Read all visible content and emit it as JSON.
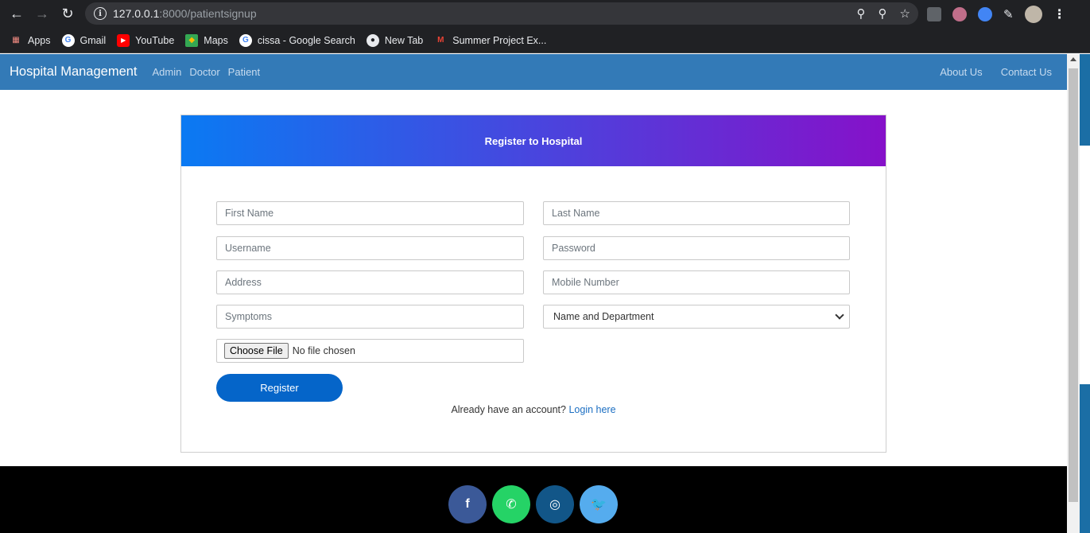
{
  "browser": {
    "url_host": "127.0.0.1",
    "url_rest": ":8000/patientsignup",
    "bookmarks": [
      {
        "label": "Apps"
      },
      {
        "label": "Gmail"
      },
      {
        "label": "YouTube"
      },
      {
        "label": "Maps"
      },
      {
        "label": "cissa - Google Search"
      },
      {
        "label": "New Tab"
      },
      {
        "label": "Summer Project Ex..."
      }
    ]
  },
  "navbar": {
    "brand": "Hospital Management",
    "left_links": [
      "Admin",
      "Doctor",
      "Patient"
    ],
    "right_links": [
      "About Us",
      "Contact Us"
    ]
  },
  "form": {
    "title": "Register to Hospital",
    "first_name_placeholder": "First Name",
    "last_name_placeholder": "Last Name",
    "username_placeholder": "Username",
    "password_placeholder": "Password",
    "address_placeholder": "Address",
    "mobile_placeholder": "Mobile Number",
    "symptoms_placeholder": "Symptoms",
    "department_selected": "Name and Department",
    "file_button": "Choose File",
    "file_status": "No file chosen",
    "submit_label": "Register",
    "login_prompt": "Already have an account?",
    "login_link": "Login here"
  },
  "footer": {
    "social": [
      {
        "name": "facebook",
        "glyph": "f",
        "color": "#3b5998"
      },
      {
        "name": "whatsapp",
        "glyph": "✆",
        "color": "#25d366"
      },
      {
        "name": "instagram",
        "glyph": "◎",
        "color": "#125688"
      },
      {
        "name": "twitter",
        "glyph": "🐦",
        "color": "#55acee"
      }
    ]
  }
}
